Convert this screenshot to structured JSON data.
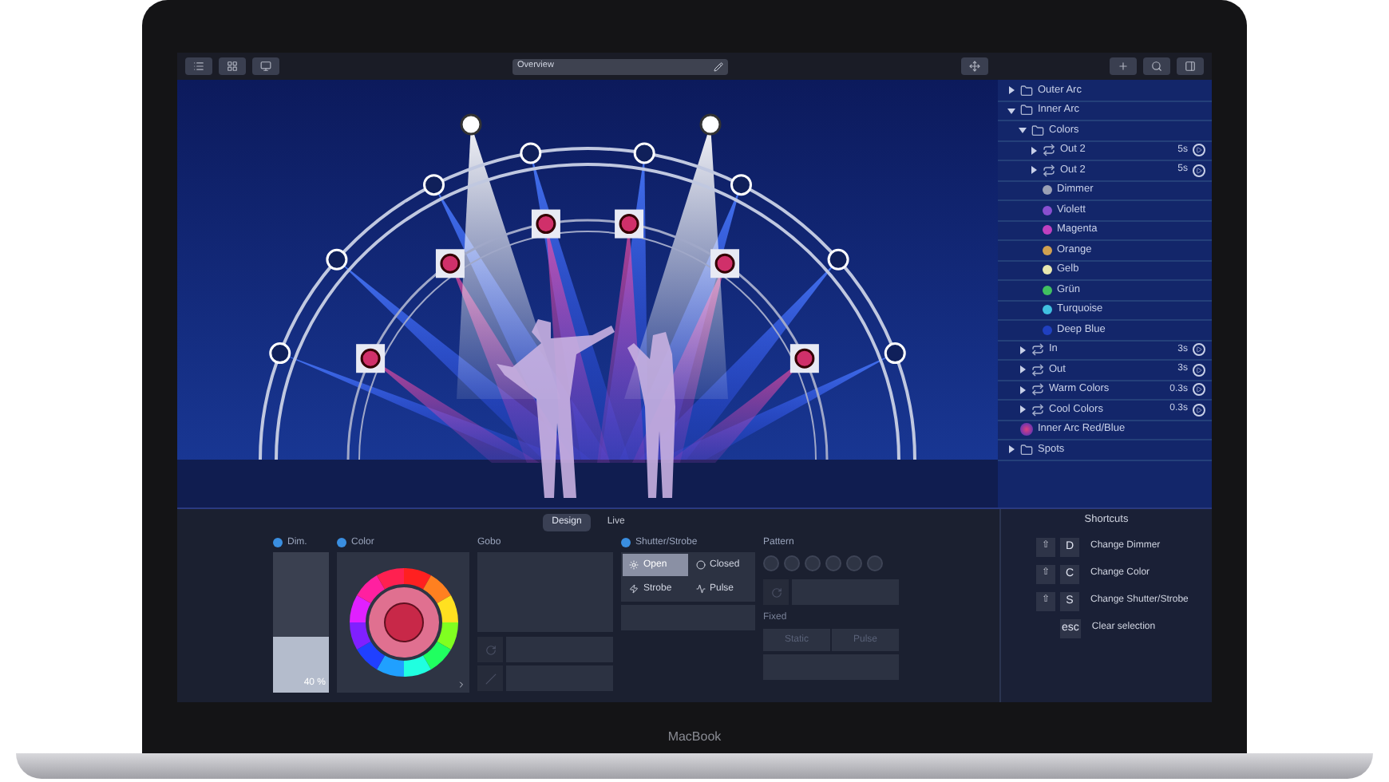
{
  "toolbar": {
    "search": {
      "value": "Overview"
    }
  },
  "tree": [
    {
      "label": "Outer Arc",
      "kind": "group",
      "expanded": false
    },
    {
      "label": "Inner Arc",
      "kind": "group",
      "expanded": true,
      "children": [
        {
          "label": "Colors",
          "kind": "group",
          "expanded": true,
          "children": [
            {
              "label": "Out 2",
              "kind": "effect",
              "expanded": false,
              "time": "5s"
            },
            {
              "label": "Out 2",
              "kind": "effect",
              "expanded": false,
              "time": "5s"
            },
            {
              "label": "Dimmer",
              "kind": "color",
              "color": "#9aa0b4"
            },
            {
              "label": "Violett",
              "kind": "color",
              "color": "#8a4fd0"
            },
            {
              "label": "Magenta",
              "kind": "color",
              "color": "#c040c0"
            },
            {
              "label": "Orange",
              "kind": "color",
              "color": "#d0a050"
            },
            {
              "label": "Gelb",
              "kind": "color",
              "color": "#e8e8b0"
            },
            {
              "label": "Grün",
              "kind": "color",
              "color": "#40c060"
            },
            {
              "label": "Turquoise",
              "kind": "color",
              "color": "#40c0e0"
            },
            {
              "label": "Deep Blue",
              "kind": "color",
              "color": "#2040c0"
            }
          ]
        },
        {
          "label": "In",
          "kind": "effect",
          "expanded": false,
          "time": "3s"
        },
        {
          "label": "Out",
          "kind": "effect",
          "expanded": false,
          "time": "3s"
        },
        {
          "label": "Warm Colors",
          "kind": "effect",
          "expanded": false,
          "time": "0.3s"
        },
        {
          "label": "Cool Colors",
          "kind": "effect",
          "expanded": false,
          "time": "0.3s"
        }
      ]
    },
    {
      "label": "Inner Arc Red/Blue",
      "kind": "preset"
    },
    {
      "label": "Spots",
      "kind": "group",
      "expanded": false
    }
  ],
  "tabs": [
    {
      "label": "Design",
      "selected": true
    },
    {
      "label": "Live",
      "selected": false
    }
  ],
  "dimmer": {
    "label": "Dim.",
    "enabled": true,
    "level": 0.4,
    "reading": "40 %"
  },
  "color": {
    "label": "Color",
    "enabled": true
  },
  "gobo": {
    "label": "Gobo",
    "enabled": false
  },
  "shutter": {
    "label": "Shutter/Strobe",
    "enabled": true,
    "options": [
      {
        "label": "Open",
        "selected": true
      },
      {
        "label": "Closed",
        "selected": false
      },
      {
        "label": "Strobe",
        "selected": false
      },
      {
        "label": "Pulse",
        "selected": false
      }
    ]
  },
  "pattern": {
    "label": "Pattern",
    "enabled": false,
    "fixed_label": "Fixed",
    "buttons": [
      "Static",
      "Pulse"
    ]
  },
  "shortcuts": {
    "title": "Shortcuts",
    "items": [
      {
        "modifier": "⇧",
        "key": "D",
        "label": "Change Dimmer"
      },
      {
        "modifier": "⇧",
        "key": "C",
        "label": "Change Color"
      },
      {
        "modifier": "⇧",
        "key": "S",
        "label": "Change Shutter/Strobe"
      },
      {
        "key": "esc",
        "label": "Clear selection"
      }
    ]
  },
  "device": {
    "label": "MacBook"
  }
}
